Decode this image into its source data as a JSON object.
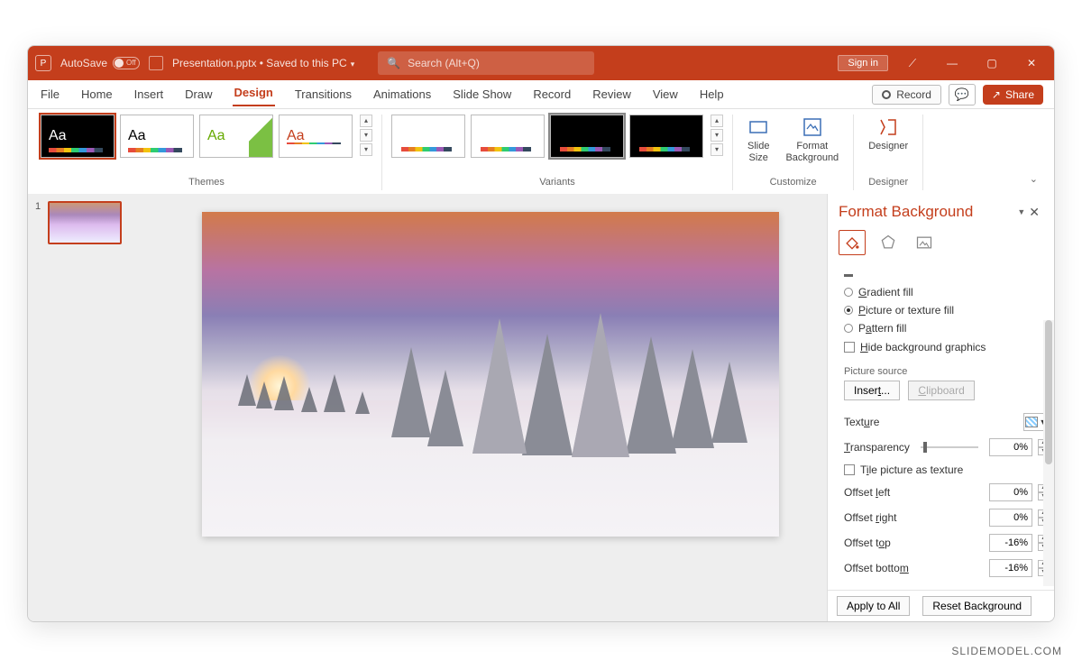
{
  "titlebar": {
    "autosave_label": "AutoSave",
    "autosave_state": "Off",
    "doc_title": "Presentation.pptx • Saved to this PC",
    "search_placeholder": "Search (Alt+Q)",
    "signin": "Sign in"
  },
  "menu": {
    "tabs": [
      "File",
      "Home",
      "Insert",
      "Draw",
      "Design",
      "Transitions",
      "Animations",
      "Slide Show",
      "Record",
      "Review",
      "View",
      "Help"
    ],
    "active_index": 4,
    "record_btn": "Record",
    "share_btn": "Share"
  },
  "ribbon": {
    "group_themes": "Themes",
    "group_variants": "Variants",
    "group_customize": "Customize",
    "group_designer": "Designer",
    "slide_size": "Slide\nSize",
    "format_bg": "Format\nBackground",
    "designer": "Designer",
    "theme_sample": "Aa"
  },
  "thumbnails": {
    "slide1_num": "1"
  },
  "pane": {
    "title": "Format Background",
    "radio_gradient": "Gradient fill",
    "radio_picture": "Picture or texture fill",
    "radio_pattern": "Pattern fill",
    "chk_hide": "Hide background graphics",
    "picture_source": "Picture source",
    "btn_insert": "Insert...",
    "btn_clipboard": "Clipboard",
    "texture": "Texture",
    "transparency": "Transparency",
    "transparency_val": "0%",
    "chk_tile": "Tile picture as texture",
    "offset_left": "Offset left",
    "offset_left_val": "0%",
    "offset_right": "Offset right",
    "offset_right_val": "0%",
    "offset_top": "Offset top",
    "offset_top_val": "-16%",
    "offset_bottom": "Offset bottom",
    "offset_bottom_val": "-16%",
    "apply_all": "Apply to All",
    "reset": "Reset Background"
  },
  "watermark": "SLIDEMODEL.COM"
}
